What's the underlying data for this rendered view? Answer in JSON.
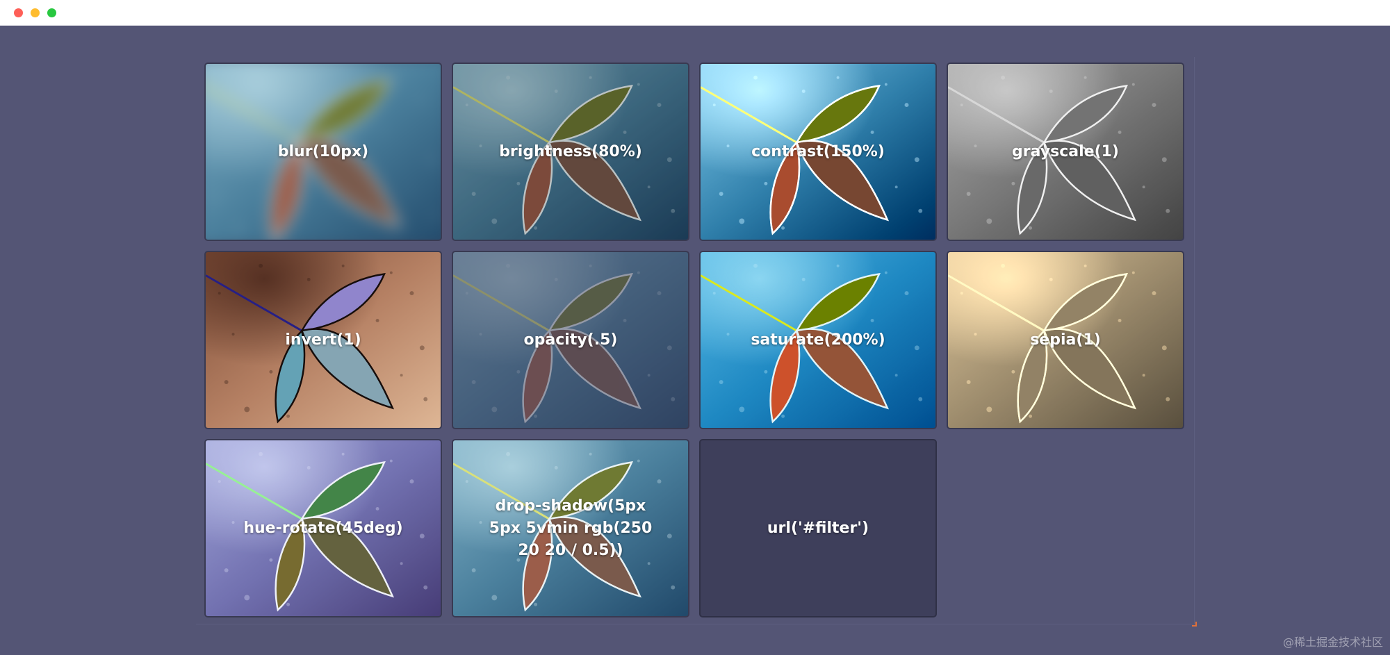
{
  "window": {
    "title": ""
  },
  "tiles": [
    {
      "label": "blur(10px)",
      "filter": "blur"
    },
    {
      "label": "brightness(80%)",
      "filter": "brightness"
    },
    {
      "label": "contrast(150%)",
      "filter": "contrast"
    },
    {
      "label": "grayscale(1)",
      "filter": "grayscale"
    },
    {
      "label": "invert(1)",
      "filter": "invert"
    },
    {
      "label": "opacity(.5)",
      "filter": "opacity"
    },
    {
      "label": "saturate(200%)",
      "filter": "saturate"
    },
    {
      "label": "sepia(1)",
      "filter": "sepia"
    },
    {
      "label": "hue-rotate(45deg)",
      "filter": "hue-rotate"
    },
    {
      "label": "drop-shadow(5px 5px 5vmin rgb(250 20 20 / 0.5))",
      "filter": "drop-shadow"
    },
    {
      "label": "url('#filter')",
      "filter": "url"
    }
  ],
  "watermark": "@稀土掘金技术社区",
  "colors": {
    "background": "#545575",
    "tile_border": "#393a52",
    "url_tile": "#3e3f5b",
    "label_text": "#ffffff"
  }
}
